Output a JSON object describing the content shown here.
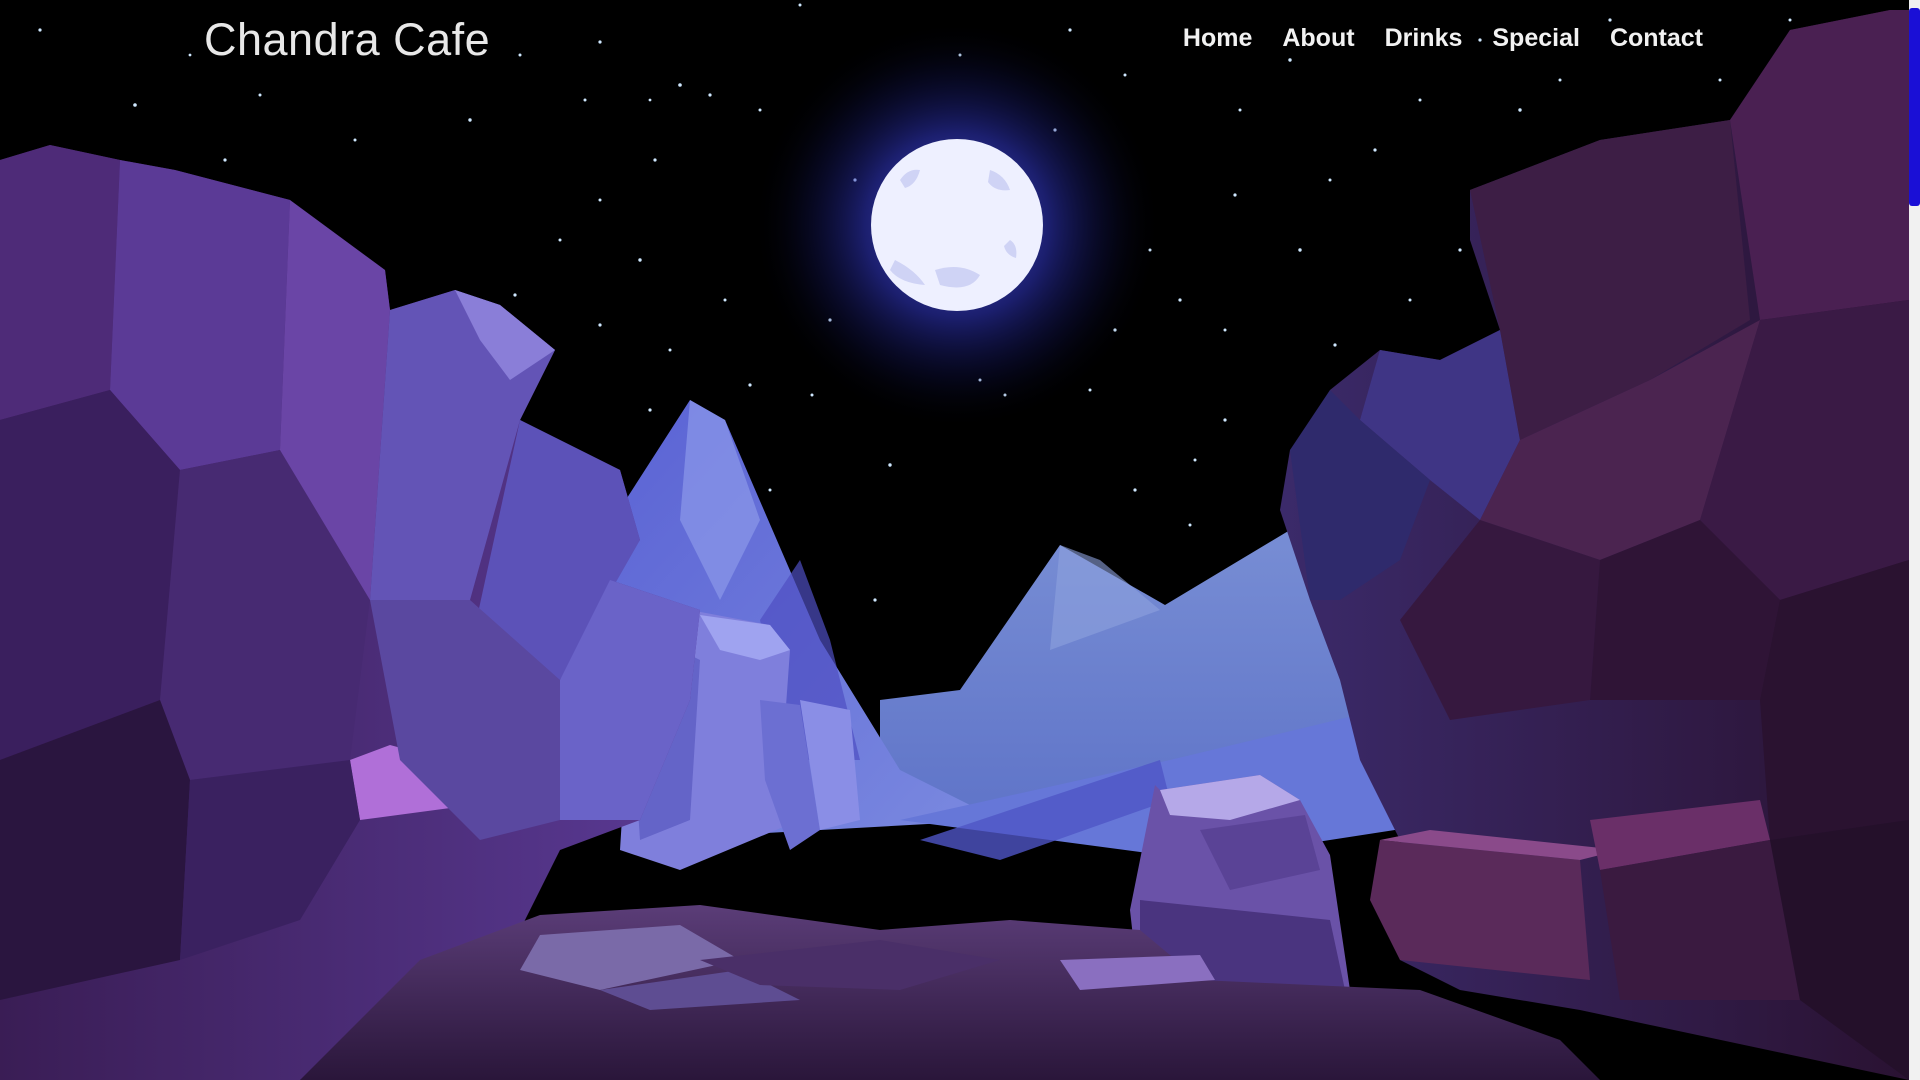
{
  "brand": {
    "name": "Chandra Cafe"
  },
  "nav": {
    "items": [
      {
        "label": "Home"
      },
      {
        "label": "About"
      },
      {
        "label": "Drinks"
      },
      {
        "label": "Special"
      },
      {
        "label": "Contact"
      }
    ]
  },
  "hero": {
    "scene": "night-canyon-moon-illustration"
  },
  "colors": {
    "sky": "#000000",
    "moon": "#ffffff",
    "moon_glow": "#3a3fd0",
    "cliff_dark": "#2a1840",
    "cliff_mid": "#4a2d78",
    "mountain_blue": "#6f7fd6",
    "scrollbar_thumb": "#1a0fd6"
  },
  "scrollbar": {
    "position_fraction": 0.0
  }
}
